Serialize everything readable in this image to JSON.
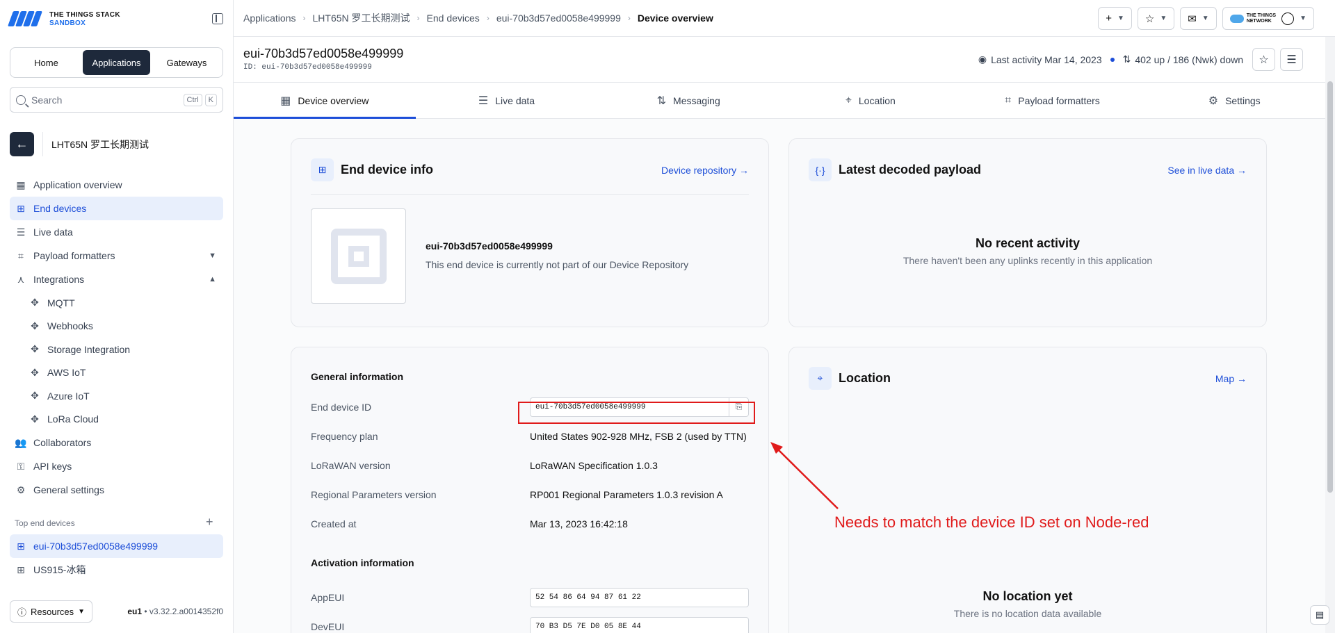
{
  "brand": {
    "line1": "THE THINGS STACK",
    "line2": "SANDBOX"
  },
  "switcher": [
    "Home",
    "Applications",
    "Gateways"
  ],
  "search": {
    "placeholder": "Search",
    "key1": "Ctrl",
    "key2": "K"
  },
  "app": {
    "name": "LHT65N 罗工长期测试"
  },
  "nav": {
    "application_overview": "Application overview",
    "end_devices": "End devices",
    "live_data": "Live data",
    "payload_formatters": "Payload formatters",
    "integrations": "Integrations",
    "mqtt": "MQTT",
    "webhooks": "Webhooks",
    "storage": "Storage Integration",
    "aws": "AWS IoT",
    "azure": "Azure IoT",
    "lora_cloud": "LoRa Cloud",
    "collaborators": "Collaborators",
    "api_keys": "API keys",
    "general_settings": "General settings"
  },
  "top_devices": {
    "heading": "Top end devices",
    "items": [
      "eui-70b3d57ed0058e499999",
      "US915-冰箱"
    ]
  },
  "footer": {
    "resources": "Resources",
    "cluster": "eu1",
    "version": " • v3.32.2.a0014352f0"
  },
  "breadcrumb": [
    "Applications",
    "LHT65N 罗工长期测试",
    "End devices",
    "eui-70b3d57ed0058e499999",
    "Device overview"
  ],
  "header_brand": {
    "l1": "THE THINGS",
    "l2": "NETWORK"
  },
  "device": {
    "title": "eui-70b3d57ed0058e499999",
    "id_label": "ID:",
    "id": "eui-70b3d57ed0058e499999",
    "last_activity": "Last activity Mar 14, 2023",
    "traffic": "402 up / 186 (Nwk) down"
  },
  "tabs": [
    "Device overview",
    "Live data",
    "Messaging",
    "Location",
    "Payload formatters",
    "Settings"
  ],
  "info_card": {
    "title": "End device info",
    "link": "Device repository →",
    "device_name": "eui-70b3d57ed0058e499999",
    "repo_note": "This end device is currently not part of our Device Repository"
  },
  "payload_card": {
    "title": "Latest decoded payload",
    "link": "See in live data →",
    "empty_title": "No recent activity",
    "empty_text": "There haven't been any uplinks recently in this application"
  },
  "general": {
    "title": "General information",
    "rows": [
      {
        "k": "End device ID",
        "v": "eui-70b3d57ed0058e499999"
      },
      {
        "k": "Frequency plan",
        "v": "United States 902-928 MHz, FSB 2 (used by TTN)"
      },
      {
        "k": "LoRaWAN version",
        "v": "LoRaWAN Specification 1.0.3"
      },
      {
        "k": "Regional Parameters version",
        "v": "RP001 Regional Parameters 1.0.3 revision A"
      },
      {
        "k": "Created at",
        "v": "Mar 13, 2023 16:42:18"
      }
    ],
    "activation_title": "Activation information",
    "appeui_label": "AppEUI",
    "appeui": "52 54 86 64 94 87 61 22",
    "deveui_label": "DevEUI",
    "deveui": "70 B3 D5 7E D0 05 8E 44"
  },
  "location_card": {
    "title": "Location",
    "link": "Map →",
    "empty_title": "No location yet",
    "empty_text": "There is no location data available"
  },
  "annotation": "Needs to match the device ID set on Node-red"
}
